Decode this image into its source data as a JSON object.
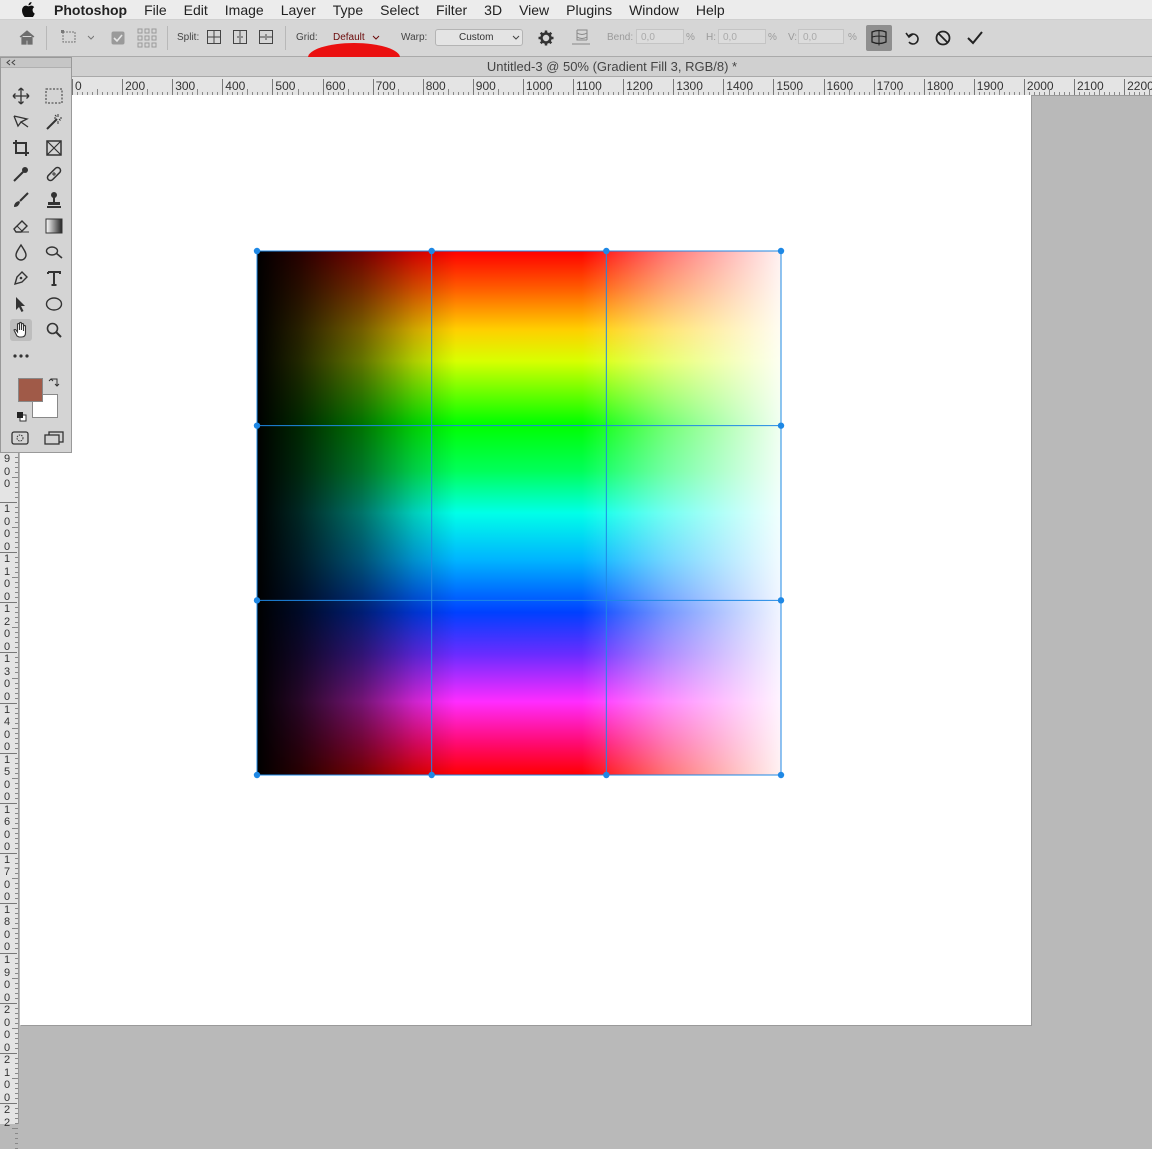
{
  "menubar": {
    "app_name": "Photoshop",
    "items": [
      "File",
      "Edit",
      "Image",
      "Layer",
      "Type",
      "Select",
      "Filter",
      "3D",
      "View",
      "Plugins",
      "Window",
      "Help"
    ]
  },
  "options_bar": {
    "split_label": "Split:",
    "grid_label": "Grid:",
    "grid_value": "Default",
    "warp_label": "Warp:",
    "warp_value": "Custom",
    "bend_label": "Bend:",
    "bend_value": "0,0",
    "h_label": "H:",
    "h_value": "0,0",
    "v_label": "V:",
    "v_value": "0,0",
    "percent": "%",
    "highlight_color": "#ea1010"
  },
  "document": {
    "title": "Untitled-3 @ 50% (Gradient Fill 3, RGB/8) *"
  },
  "ruler": {
    "h_labels": [
      "0",
      "200",
      "300",
      "400",
      "500",
      "600",
      "700",
      "800",
      "900",
      "1000",
      "1100",
      "1200",
      "1300",
      "1400",
      "1500",
      "1600",
      "1700",
      "1800",
      "1900",
      "2000",
      "2100",
      "2200"
    ],
    "v_labels": [
      "900",
      "1000",
      "1100",
      "1200",
      "1300",
      "1400",
      "1500",
      "1600",
      "1700",
      "1800",
      "1900",
      "2000",
      "2100",
      "22"
    ]
  },
  "toolbox": {
    "foreground_color": "#a05a48",
    "background_color": "#ffffff",
    "tools": [
      "move-tool",
      "marquee-tool",
      "lasso-tool",
      "magic-wand-tool",
      "crop-tool",
      "frame-tool",
      "eyedropper-tool",
      "healing-brush-tool",
      "brush-tool",
      "clone-stamp-tool",
      "eraser-tool",
      "gradient-tool",
      "blur-tool",
      "dodge-tool",
      "pen-tool",
      "type-tool",
      "path-selection-tool",
      "ellipse-tool",
      "hand-tool",
      "zoom-tool",
      "edit-toolbar"
    ]
  },
  "warp": {
    "selection_color": "#1e88e5"
  }
}
